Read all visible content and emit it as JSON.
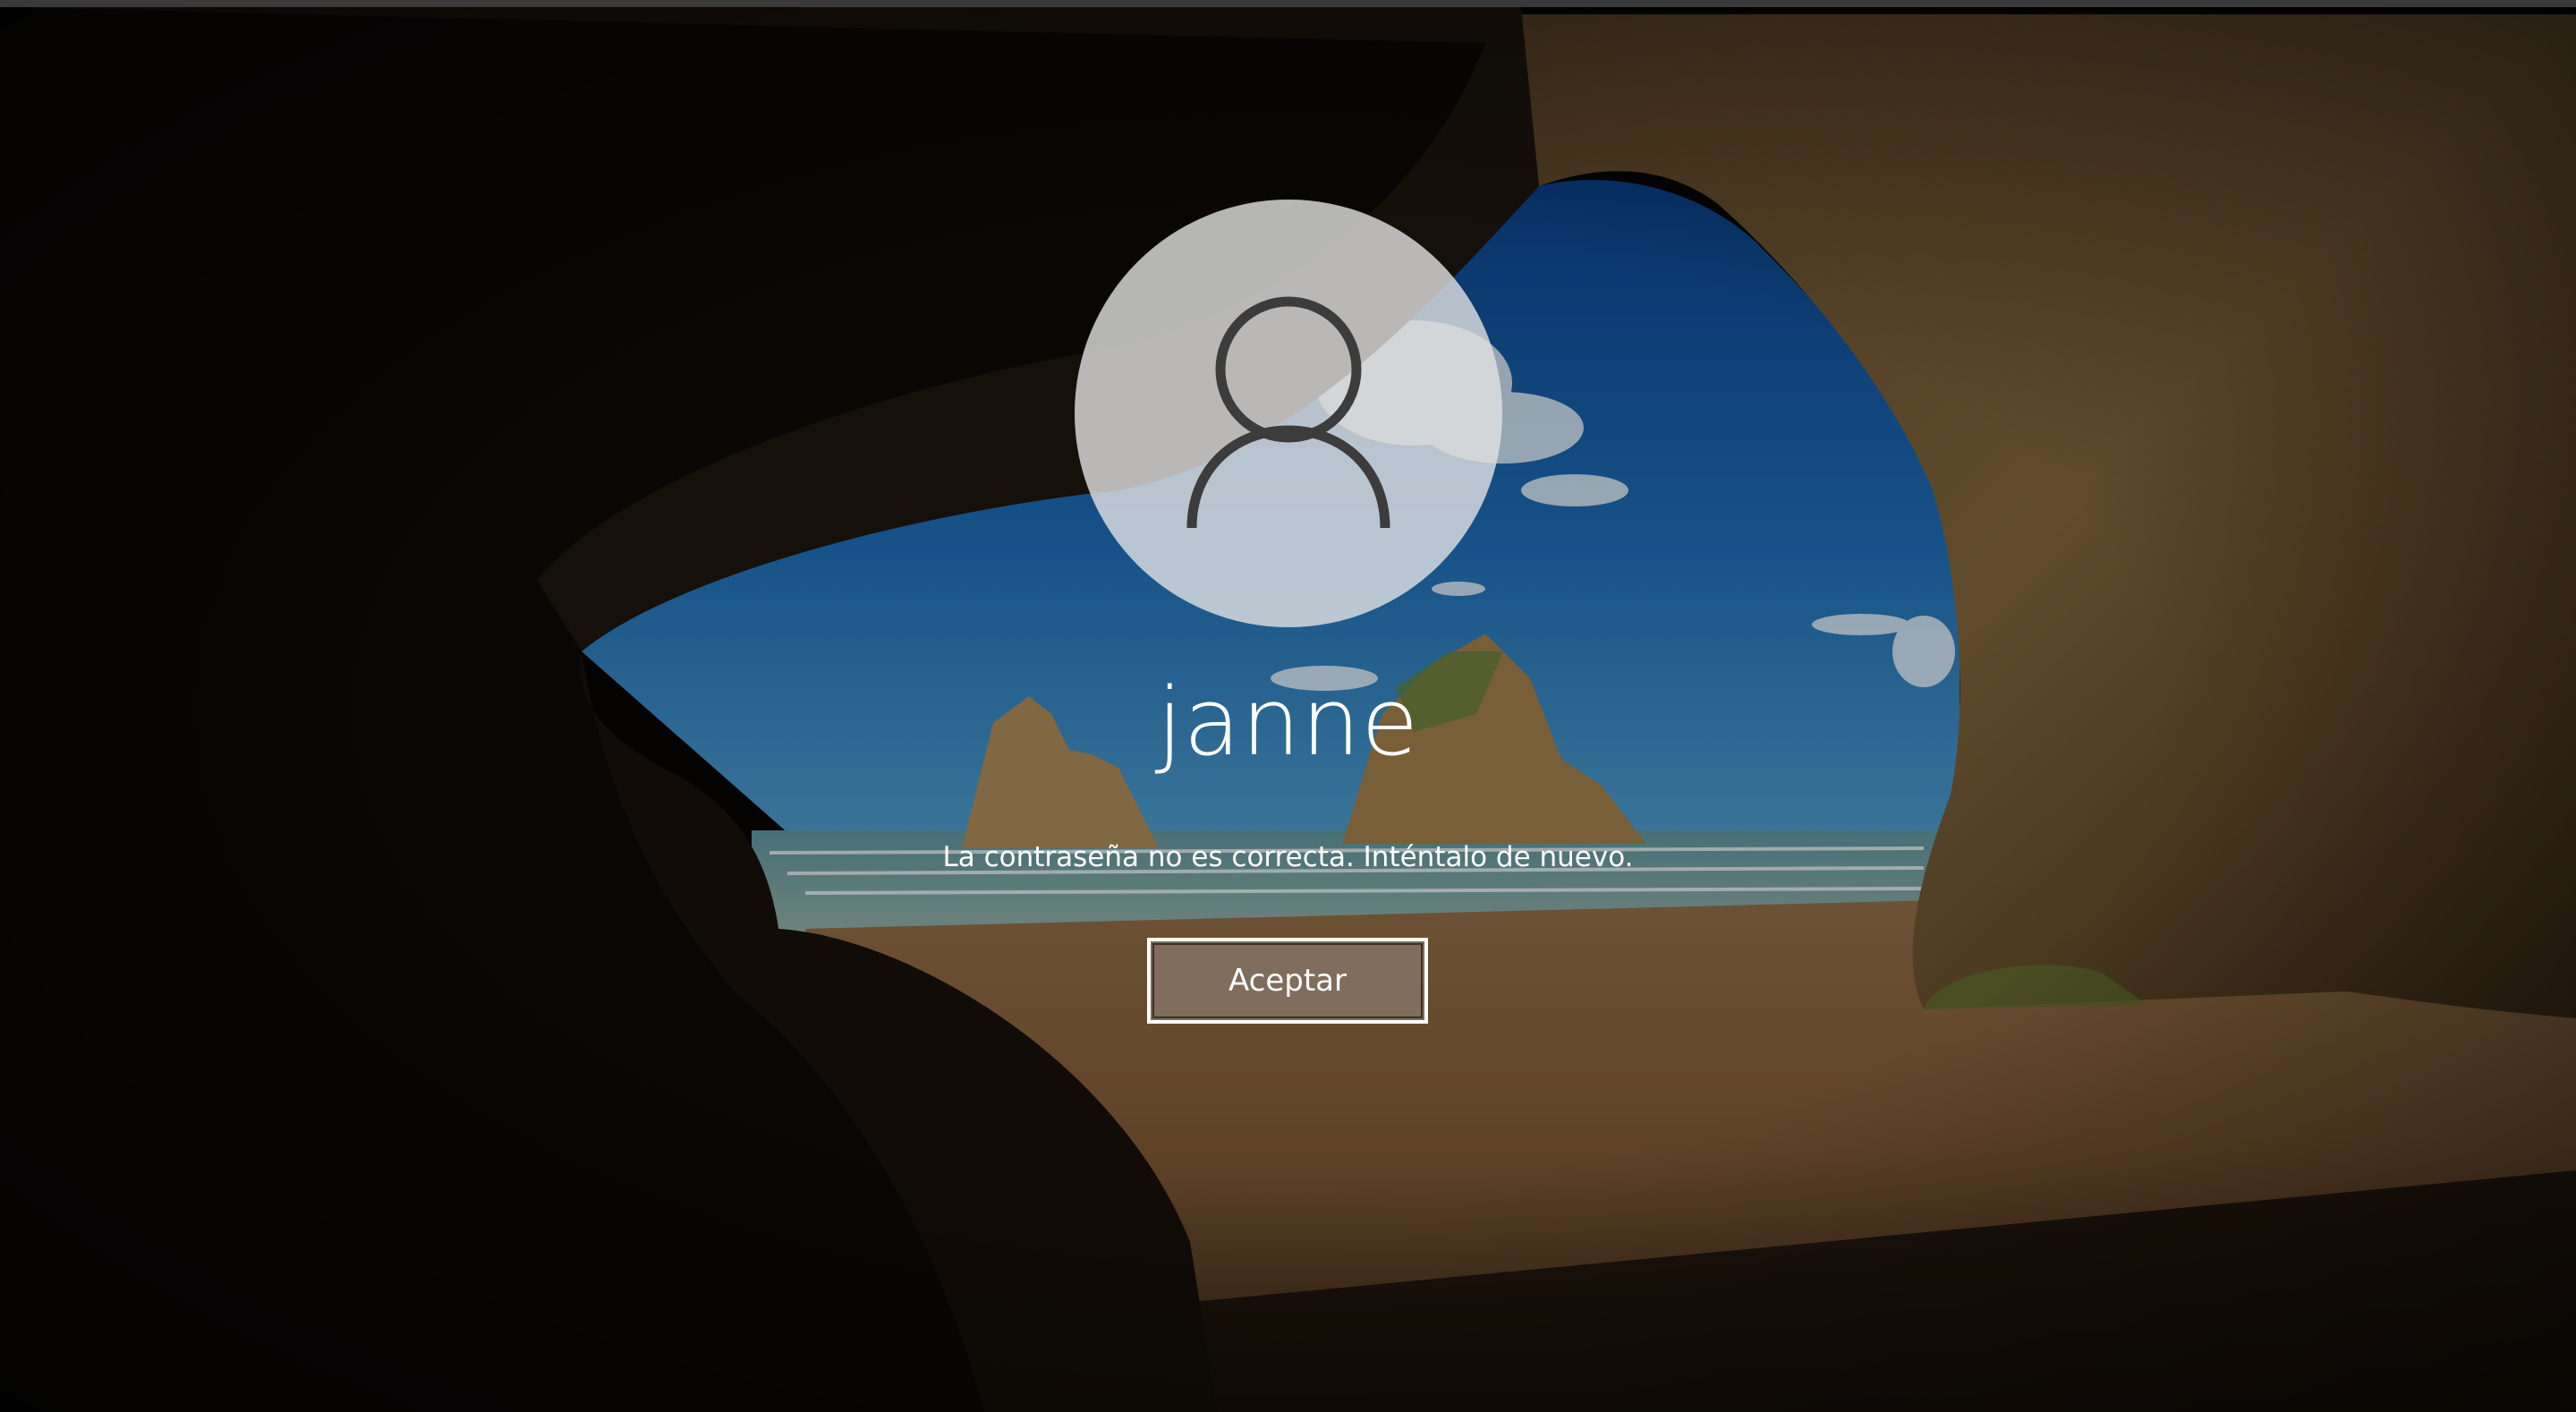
{
  "lock_screen": {
    "user": {
      "name": "janne",
      "avatar_icon": "user-silhouette-icon"
    },
    "error_message": "La contraseña no es correcta. Inténtalo de nuevo.",
    "ok_button_label": "Aceptar"
  },
  "theme": {
    "text_color": "#ffffff",
    "button_background": "#827060",
    "button_border": "#ffffff",
    "avatar_background": "#e2e2e2",
    "avatar_icon_color": "#3c3c3c"
  }
}
